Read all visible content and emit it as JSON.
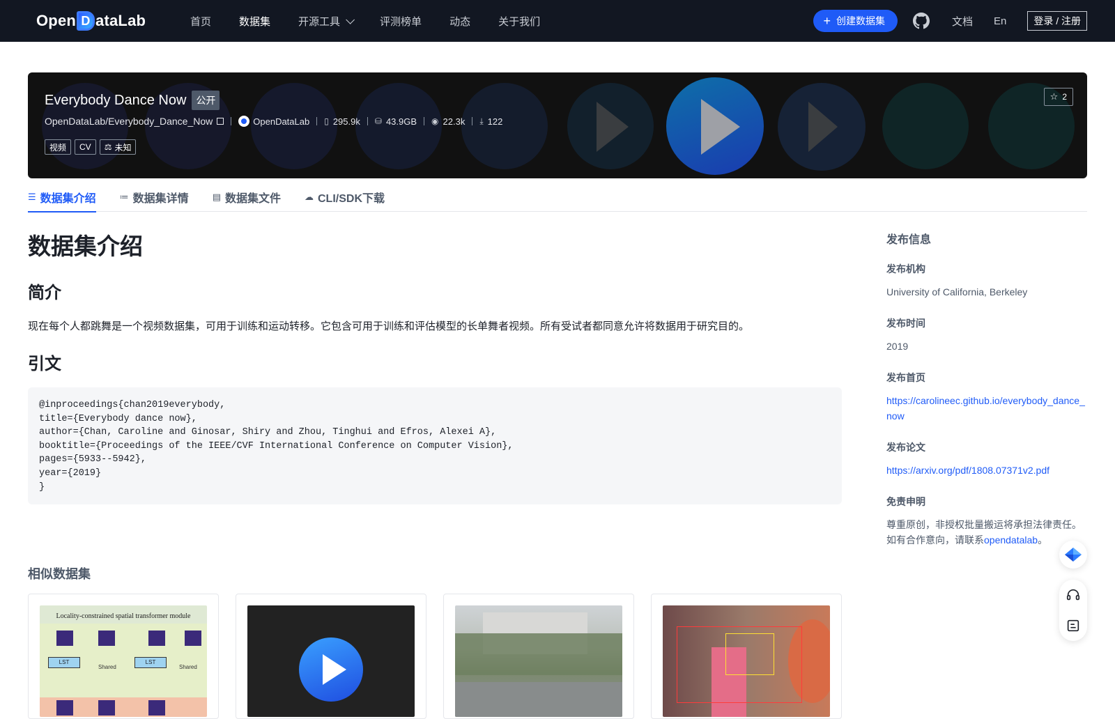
{
  "nav": {
    "logo": "OpenDataLab",
    "items": [
      {
        "label": "首页"
      },
      {
        "label": "数据集"
      },
      {
        "label": "开源工具"
      },
      {
        "label": "评测榜单"
      },
      {
        "label": "动态"
      },
      {
        "label": "关于我们"
      }
    ],
    "create_label": "创建数据集",
    "docs_label": "文档",
    "lang_label": "En",
    "login_label": "登录 / 注册"
  },
  "hero": {
    "title": "Everybody Dance Now",
    "visibility": "公开",
    "repo": "OpenDataLab/Everybody_Dance_Now",
    "org": "OpenDataLab",
    "files": "295.9k",
    "size": "43.9GB",
    "views": "22.3k",
    "downloads": "122",
    "tags": [
      "视频",
      "CV",
      "未知"
    ],
    "stars": "2"
  },
  "tabs": [
    {
      "label": "数据集介绍"
    },
    {
      "label": "数据集详情"
    },
    {
      "label": "数据集文件"
    },
    {
      "label": "CLI/SDK下载"
    }
  ],
  "content": {
    "heading": "数据集介绍",
    "intro_heading": "简介",
    "intro_text": "现在每个人都跳舞是一个视频数据集，可用于训练和运动转移。它包含可用于训练和评估模型的长单舞者视频。所有受试者都同意允许将数据用于研究目的。",
    "citation_heading": "引文",
    "citation": "@inproceedings{chan2019everybody,\ntitle={Everybody dance now},\nauthor={Chan, Caroline and Ginosar, Shiry and Zhou, Tinghui and Efros, Alexei A},\nbooktitle={Proceedings of the IEEE/CVF International Conference on Computer Vision},\npages={5933--5942},\nyear={2019}\n}",
    "similar_heading": "相似数据集"
  },
  "sidebar": {
    "title": "发布信息",
    "org_label": "发布机构",
    "org_value": "University of California, Berkeley",
    "time_label": "发布时间",
    "time_value": "2019",
    "home_label": "发布首页",
    "home_value": "https://carolineec.github.io/everybody_dance_now",
    "paper_label": "发布论文",
    "paper_value": "https://arxiv.org/pdf/1808.07371v2.pdf",
    "disclaimer_label": "免责申明",
    "disclaimer_text": "尊重原创，非授权批量搬运将承担法律责任。如有合作意向，请联系",
    "disclaimer_link": "opendatalab",
    "disclaimer_end": "。"
  },
  "cards": {
    "card1_title": "Locality-constrained spatial transformer module",
    "card1_lst": "LST",
    "card1_shared": "Shared"
  },
  "colors": {
    "nav_bg": "#121722",
    "accent": "#1f5bf7",
    "hero_bg": "#111111"
  }
}
